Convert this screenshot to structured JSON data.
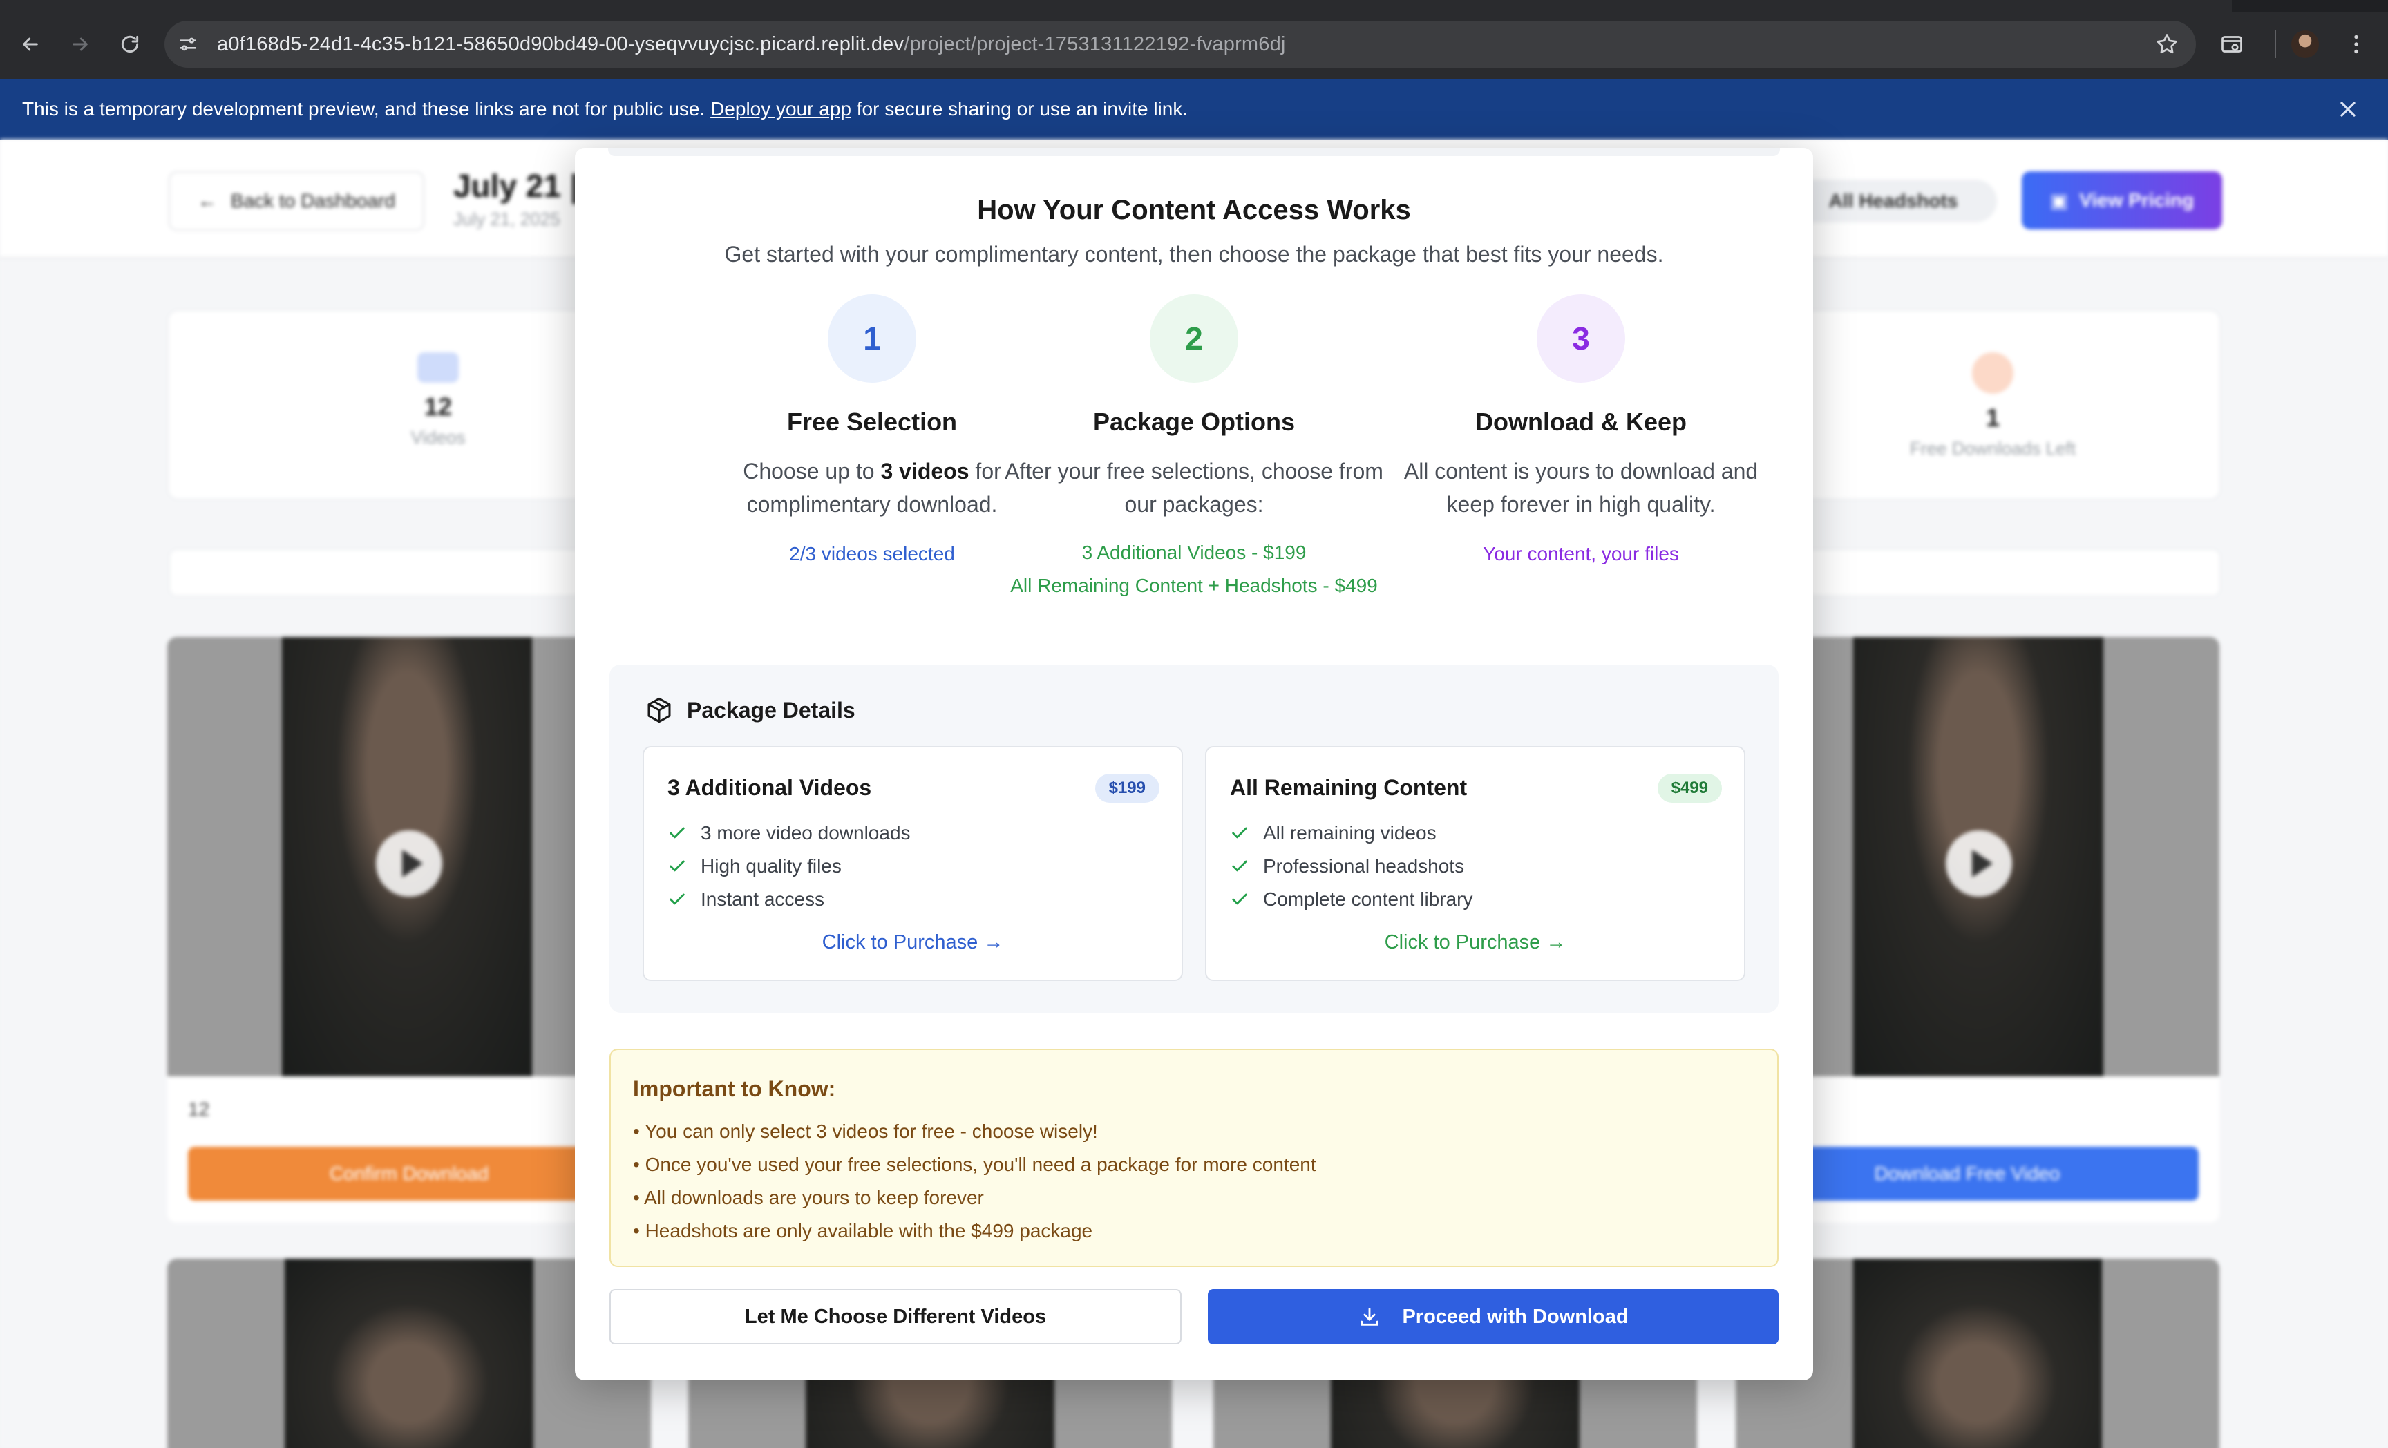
{
  "browser": {
    "url_host": "a0f168d5-24d1-4c35-b121-58650d90bd49-00-yseqvvuycjsc.picard.replit.dev",
    "url_path": "/project/project-1753131122192-fvaprm6dj"
  },
  "notice": {
    "text_before": "This is a temporary development preview, and these links are not for public use.",
    "link": "Deploy your app",
    "text_after": "for secure sharing or use an invite link."
  },
  "background": {
    "back_label": "Back to Dashboard",
    "title": "July 21 |",
    "subtitle": "July 21, 2025",
    "headshots_badge": "All Headshots",
    "pricing_button": "View Pricing",
    "stats": [
      {
        "num": "12",
        "label": "Videos",
        "color": "#5b8cf5"
      },
      {
        "num": "1",
        "label": "Free Downloads Left",
        "color": "#f79a6a"
      }
    ],
    "card_number": "12",
    "confirm_label": "Confirm Download",
    "download_free_label": "Download Free Video"
  },
  "modal": {
    "title": "How Your Content Access Works",
    "subtitle": "Get started with your complimentary content, then choose the package that best fits your needs.",
    "steps": [
      {
        "num": "1",
        "title": "Free Selection",
        "desc_pre": "Choose up to",
        "desc_bold": "3 videos",
        "desc_post": "for complimentary download.",
        "notes": [
          "2/3 videos selected"
        ],
        "color": "#2f5fcf",
        "circle_bg": "#eaf1fd"
      },
      {
        "num": "2",
        "title": "Package Options",
        "desc": "After your free selections, choose from our packages:",
        "notes": [
          "3 Additional Videos - $199",
          "All Remaining Content + Headshots - $499"
        ],
        "color": "#2e9d4a",
        "circle_bg": "#ebf8ee"
      },
      {
        "num": "3",
        "title": "Download & Keep",
        "desc": "All content is yours to download and keep forever in high quality.",
        "notes": [
          "Your content, your files"
        ],
        "color": "#8a2be2",
        "circle_bg": "#f4ecfd"
      }
    ],
    "package_details": {
      "heading": "Package Details",
      "packages": [
        {
          "title": "3 Additional Videos",
          "price": "$199",
          "features": [
            "3 more video downloads",
            "High quality files",
            "Instant access"
          ],
          "cta": "Click to Purchase →",
          "cta_color": "#2f5fcf",
          "price_bg": "#e2ebfb",
          "price_color": "#274fae"
        },
        {
          "title": "All Remaining Content",
          "price": "$499",
          "features": [
            "All remaining videos",
            "Professional headshots",
            "Complete content library"
          ],
          "cta": "Click to Purchase →",
          "cta_color": "#2e9d4a",
          "price_bg": "#e1f5e6",
          "price_color": "#1f7a37"
        }
      ]
    },
    "important": {
      "title": "Important to Know:",
      "items": [
        "• You can only select 3 videos for free - choose wisely!",
        "• Once you've used your free selections, you'll need a package for more content",
        "• All downloads are yours to keep forever",
        "• Headshots are only available with the $499 package"
      ]
    },
    "secondary_button": "Let Me Choose Different Videos",
    "primary_button": "Proceed with Download"
  }
}
